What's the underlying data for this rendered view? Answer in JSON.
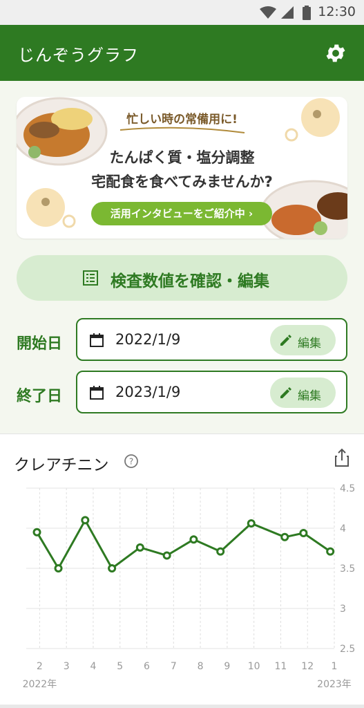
{
  "status_bar": {
    "time": "12:30"
  },
  "app_bar": {
    "title": "じんぞうグラフ"
  },
  "banner": {
    "kicker": "忙しい時の常備用に!",
    "headline_1": "たんぱく質・塩分調整",
    "headline_2": "宅配食を食べてみませんか?",
    "cta": "活用インタビューをご紹介中 ›"
  },
  "check_button": {
    "label": "検査数値を確認・編集"
  },
  "date_range": {
    "start_label": "開始日",
    "start_value": "2022/1/9",
    "end_label": "終了日",
    "end_value": "2023/1/9",
    "edit_label": "編集"
  },
  "chart_card": {
    "title": "クレアチニン"
  },
  "colors": {
    "brand_green": "#2e7a22",
    "light_green": "#d7ecd0",
    "cta_green": "#7bb832"
  },
  "chart_data": {
    "type": "line",
    "title": "クレアチニン",
    "x_tick_labels": [
      "2",
      "3",
      "4",
      "5",
      "6",
      "7",
      "8",
      "9",
      "10",
      "11",
      "12",
      "1"
    ],
    "x_year_labels": [
      {
        "label": "2022年",
        "at_month_index": 0
      },
      {
        "label": "2023年",
        "at_month_index": 11
      }
    ],
    "y_ticks": [
      4.5,
      4,
      3.5,
      3,
      2.5
    ],
    "y_tick_labels": [
      "4.5",
      "4",
      "3.5",
      "3",
      "2.5"
    ],
    "ylim": [
      2.5,
      4.5
    ],
    "x_axis_start": 0.5,
    "x_axis_end": 12.0,
    "series": [
      {
        "color": "#2e7a22",
        "points": [
          {
            "x": 0.9,
            "y": 3.95
          },
          {
            "x": 1.7,
            "y": 3.5
          },
          {
            "x": 2.7,
            "y": 4.1
          },
          {
            "x": 3.7,
            "y": 3.5
          },
          {
            "x": 4.75,
            "y": 3.76
          },
          {
            "x": 5.75,
            "y": 3.66
          },
          {
            "x": 6.75,
            "y": 3.86
          },
          {
            "x": 7.75,
            "y": 3.71
          },
          {
            "x": 8.9,
            "y": 4.06
          },
          {
            "x": 10.15,
            "y": 3.89
          },
          {
            "x": 10.85,
            "y": 3.94
          },
          {
            "x": 11.85,
            "y": 3.71
          }
        ]
      }
    ],
    "grid": true
  }
}
